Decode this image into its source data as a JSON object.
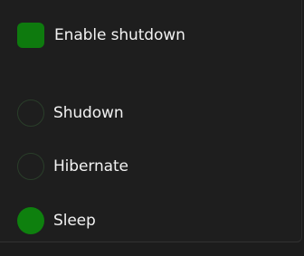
{
  "options": {
    "enable_shutdown": {
      "label": "Enable shutdown",
      "checked": true
    },
    "power_modes": [
      {
        "label": "Shudown",
        "selected": false
      },
      {
        "label": "Hibernate",
        "selected": false
      },
      {
        "label": "Sleep",
        "selected": true
      }
    ]
  },
  "colors": {
    "accent": "#0e7a0e",
    "background": "#1e1e1e",
    "radio_border": "#2a3e2a",
    "text": "#f2f2f2"
  }
}
